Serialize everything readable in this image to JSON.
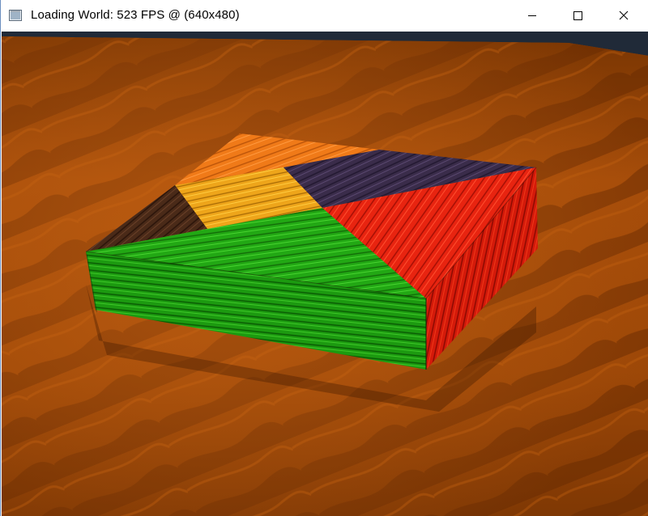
{
  "window": {
    "title": "Loading World: 523 FPS @ (640x480)",
    "icon": "application-window-icon",
    "controls": {
      "minimize": "minimize-icon",
      "maximize": "maximize-icon",
      "close": "close-icon"
    }
  },
  "scene": {
    "floor_color": "#a8500a",
    "floor_shadow_color": "#6b2c02",
    "background_color": "#1c2430",
    "puzzle_pieces": [
      {
        "name": "orange-triangle",
        "color": "#f07a18"
      },
      {
        "name": "yellow-triangle",
        "color": "#f0a018"
      },
      {
        "name": "dark-purple-triangle",
        "color": "#3a2a48"
      },
      {
        "name": "brown-triangle",
        "color": "#4a2a1a"
      },
      {
        "name": "green-triangle",
        "color": "#1fa812"
      },
      {
        "name": "red-triangle",
        "color": "#e8200c"
      }
    ]
  }
}
